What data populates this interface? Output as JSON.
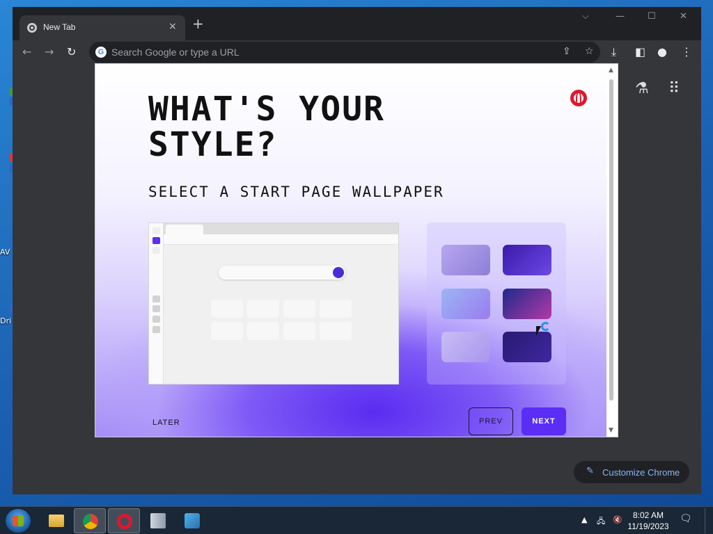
{
  "desktop": {
    "icon_labels": [
      "AV",
      "Dri"
    ]
  },
  "browser": {
    "tab_title": "New Tab",
    "new_tab_symbol": "+",
    "close_tab_symbol": "×",
    "omnibox_placeholder": "Search Google or type a URL",
    "google_letter": "G",
    "customize_label": "Customize Chrome"
  },
  "modal": {
    "headline": "WHAT'S YOUR\nSTYLE?",
    "subheading": "SELECT A START PAGE WALLPAPER",
    "later_label": "LATER",
    "prev_label": "PREV",
    "next_label": "NEXT",
    "wallpapers": [
      {
        "name": "lilac-waves",
        "colors": [
          "#b8a6ef",
          "#8c7fd8"
        ]
      },
      {
        "name": "purple-swirl",
        "colors": [
          "#3b1aa8",
          "#6c47e6"
        ]
      },
      {
        "name": "blue-haze",
        "colors": [
          "#9bb6f4",
          "#9b7bf0"
        ]
      },
      {
        "name": "dark-aurora",
        "colors": [
          "#1e2a8a",
          "#b23aa8"
        ]
      },
      {
        "name": "lavender-mist",
        "colors": [
          "#c8bdf5",
          "#a996ee"
        ]
      },
      {
        "name": "deep-violet",
        "colors": [
          "#2a1a72",
          "#3e27a0"
        ]
      }
    ]
  },
  "taskbar": {
    "time": "8:02 AM",
    "date": "11/19/2023"
  },
  "colors": {
    "opera_red": "#e0162b",
    "accent_purple": "#5b2df5",
    "chrome_dark": "#35363a"
  }
}
